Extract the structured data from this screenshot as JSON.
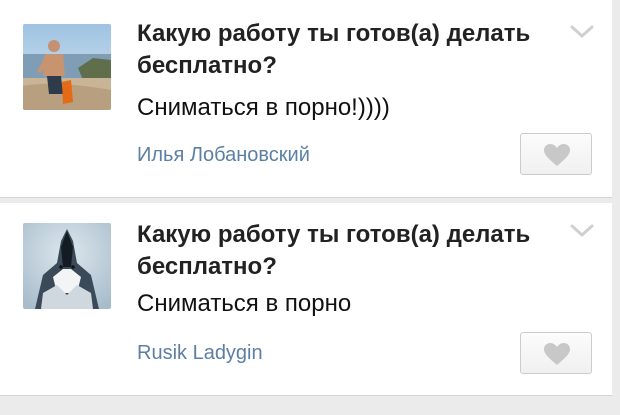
{
  "posts": [
    {
      "question": "Какую работу ты готов(а) делать бесплатно?",
      "answer": "Сниматься в порно!))))",
      "author": "Илья Лобановский",
      "avatar_icon": "person-at-beach-photo",
      "chevron_icon": "chevron-down-icon",
      "like_icon": "heart-icon"
    },
    {
      "question": "Какую работу ты готов(а) делать бесплатно?",
      "answer": "Сниматься в порно",
      "author": "Rusik Ladygin",
      "avatar_icon": "howling-wolf-photo",
      "chevron_icon": "chevron-down-icon",
      "like_icon": "heart-icon"
    }
  ],
  "colors": {
    "author_link": "#5c7fa3",
    "heart": "#c8c8c8",
    "chevron": "#d0d0d0"
  }
}
